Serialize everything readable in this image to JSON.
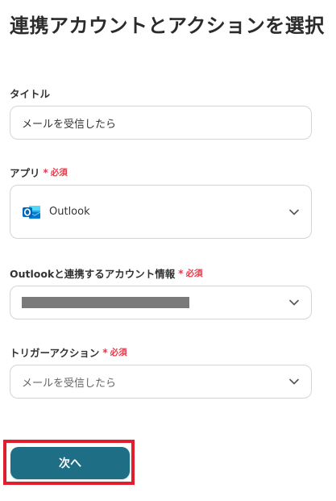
{
  "page": {
    "title": "連携アカウントとアクションを選択"
  },
  "fields": {
    "title": {
      "label": "タイトル",
      "value": "メールを受信したら"
    },
    "app": {
      "label": "アプリ",
      "required_mark": "*",
      "required_text": "必須",
      "selected": "Outlook",
      "icon": "outlook-icon"
    },
    "account": {
      "label": "Outlookと連携するアカウント情報",
      "required_mark": "*",
      "required_text": "必須"
    },
    "trigger": {
      "label": "トリガーアクション",
      "required_mark": "*",
      "required_text": "必須",
      "selected": "メールを受信したら"
    }
  },
  "actions": {
    "next_label": "次へ"
  },
  "colors": {
    "primary": "#1e6e86",
    "required": "#e03c4c",
    "highlight": "#e01e2d",
    "redaction": "#7a7a7a"
  }
}
